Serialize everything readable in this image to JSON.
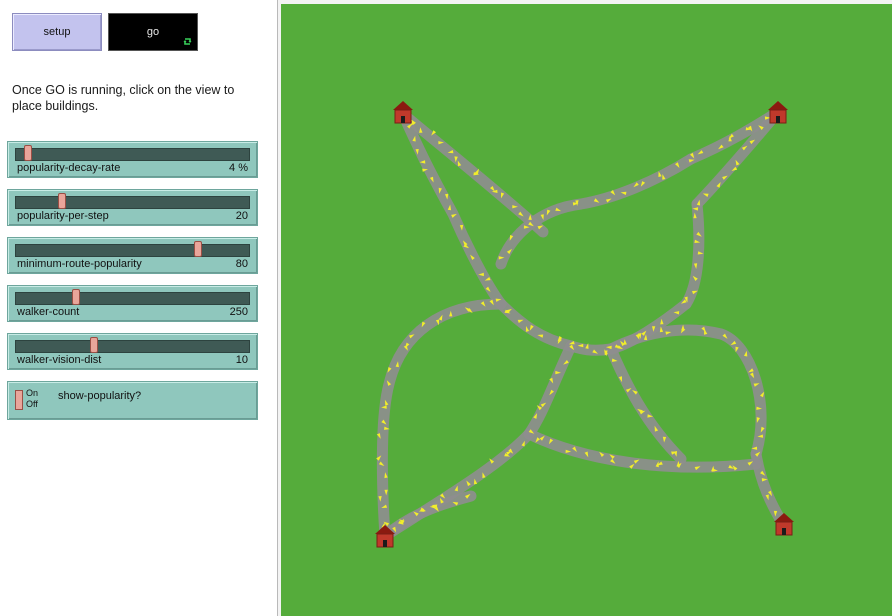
{
  "buttons": {
    "setup_label": "setup",
    "go_label": "go"
  },
  "instructions": "Once GO is running, click on the view to place buildings.",
  "sliders": [
    {
      "name": "popularity-decay-rate",
      "value_text": "4 %",
      "position": 0.04
    },
    {
      "name": "popularity-per-step",
      "value_text": "20",
      "position": 0.19
    },
    {
      "name": "minimum-route-popularity",
      "value_text": "80",
      "position": 0.79
    },
    {
      "name": "walker-count",
      "value_text": "250",
      "position": 0.25
    },
    {
      "name": "walker-vision-dist",
      "value_text": "10",
      "position": 0.33
    }
  ],
  "switch": {
    "on_label": "On",
    "off_label": "Off",
    "name": "show-popularity?",
    "state": "on"
  },
  "world": {
    "background_color": "#55ac3b",
    "path_color": "#8e8e8e",
    "walker_color": "#f2ee2a",
    "building_color": "#c0392b",
    "building_icon": "house-icon",
    "building_count": 4
  }
}
